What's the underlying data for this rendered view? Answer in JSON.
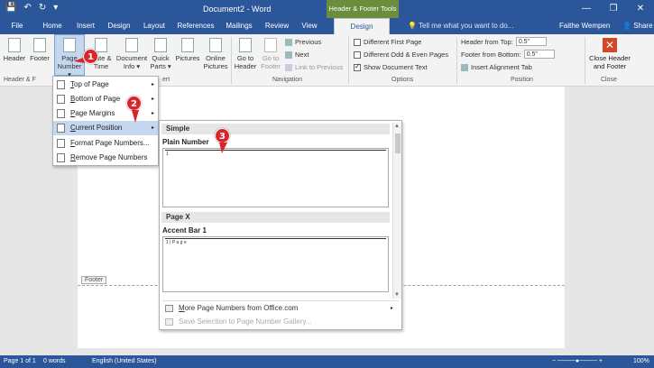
{
  "window": {
    "title": "Document2 - Word",
    "context_tab_group": "Header & Footer Tools",
    "minimize": "—",
    "restore": "❐",
    "close": "✕"
  },
  "qat": {
    "save": "💾",
    "undo": "↶",
    "redo": "↻",
    "customize": "▾"
  },
  "tabs": {
    "file": "File",
    "home": "Home",
    "insert": "Insert",
    "design": "Design",
    "layout": "Layout",
    "references": "References",
    "mailings": "Mailings",
    "review": "Review",
    "view": "View",
    "hf_design": "Design"
  },
  "tellme": "Tell me what you want to do...",
  "user": "Faithe Wempen",
  "share": "Share",
  "ribbon": {
    "header": "Header",
    "footer": "Footer",
    "page_number_1": "Page",
    "page_number_2": "Number ▾",
    "date_time_1": "Date &",
    "date_time_2": "Time",
    "doc_info_1": "Document",
    "doc_info_2": "Info ▾",
    "quick_parts_1": "Quick",
    "quick_parts_2": "Parts ▾",
    "pictures": "Pictures",
    "online_pictures_1": "Online",
    "online_pictures_2": "Pictures",
    "goto_header_1": "Go to",
    "goto_header_2": "Header",
    "goto_footer_1": "Go to",
    "goto_footer_2": "Footer",
    "previous": "Previous",
    "next": "Next",
    "link_prev": "Link to Previous",
    "diff_first": "Different First Page",
    "diff_oddeven": "Different Odd & Even Pages",
    "show_doc_text": "Show Document Text",
    "header_from_top": "Header from Top:",
    "footer_from_bottom": "Footer from Bottom:",
    "header_from_top_value": "0.5\"",
    "footer_from_bottom_value": "0.5\"",
    "insert_alignment_tab": "Insert Alignment Tab",
    "close_1": "Close Header",
    "close_2": "and Footer",
    "group_hf": "Header & F",
    "group_insert": "ert",
    "group_navigation": "Navigation",
    "group_options": "Options",
    "group_position": "Position",
    "group_close": "Close"
  },
  "page_number_menu": {
    "items": [
      {
        "pre": "",
        "u": "T",
        "post": "op of Page",
        "arrow": "▸"
      },
      {
        "pre": "",
        "u": "B",
        "post": "ottom of Page",
        "arrow": "▸"
      },
      {
        "pre": "",
        "u": "P",
        "post": "age Margins",
        "arrow": "▸"
      },
      {
        "pre": "",
        "u": "C",
        "post": "urrent Position",
        "arrow": "▸"
      },
      {
        "pre": "",
        "u": "F",
        "post": "ormat Page Numbers...",
        "arrow": ""
      },
      {
        "pre": "",
        "u": "R",
        "post": "emove Page Numbers",
        "arrow": ""
      }
    ]
  },
  "gallery": {
    "simple_header": "Simple",
    "plain_number": "Plain Number",
    "plain_number_preview": "1",
    "pagex_header": "Page X",
    "accent_bar": "Accent Bar 1",
    "accent_bar_preview": "1 | P a g e",
    "more_pre": "",
    "more_u": "M",
    "more_post": "ore Page Numbers from Office.com",
    "more_arrow": "▸",
    "save_selection": "Save Selection to Page Number Gallery..."
  },
  "doc": {
    "footer_tag": "Footer"
  },
  "status": {
    "page": "Page 1 of 1",
    "words": "0 words",
    "lang": "English (United States)",
    "zoom": "100%"
  },
  "callouts": [
    "1",
    "2",
    "3"
  ]
}
